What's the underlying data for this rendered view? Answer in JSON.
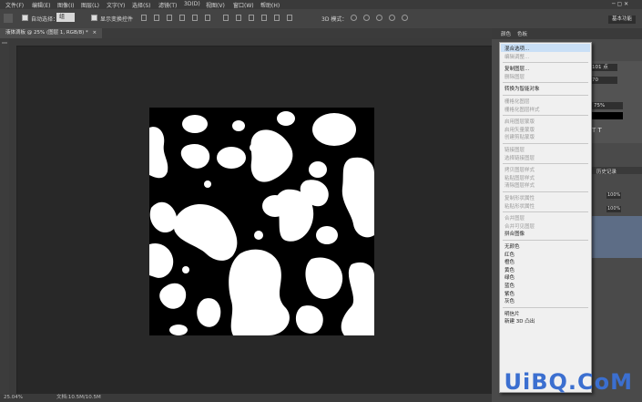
{
  "menubar": {
    "items": [
      "文件(F)",
      "编辑(E)",
      "图像(I)",
      "图层(L)",
      "文字(Y)",
      "选择(S)",
      "滤镜(T)",
      "3D(D)",
      "视图(V)",
      "窗口(W)",
      "帮助(H)"
    ],
    "workspace_label": "基本功能"
  },
  "options_bar": {
    "auto_select_label": "自动选择：",
    "auto_select_value": "组",
    "show_transform_label": "显示变换控件",
    "mode_3d_label": "3D 模式："
  },
  "document": {
    "tab_title": "液体滴板 @ 25% (图层 1, RGB/8) *",
    "close_glyph": "×"
  },
  "status_bar": {
    "zoom": "25.04%",
    "doc_info": "文档:10.5M/10.5M"
  },
  "right_panel": {
    "tabs": [
      "颜色",
      "色板"
    ],
    "values": [
      "101 点",
      "70",
      "75%",
      "100%",
      "100%"
    ],
    "history_tab": "历史记录"
  },
  "context_menu": {
    "items": [
      {
        "label": "混合选项...",
        "enabled": true,
        "highlighted": true
      },
      {
        "label": "编辑调整...",
        "enabled": false
      },
      {
        "sep": true
      },
      {
        "label": "复制图层...",
        "enabled": true
      },
      {
        "label": "删除图层",
        "enabled": false
      },
      {
        "sep": true
      },
      {
        "label": "转换为智能对象",
        "enabled": true
      },
      {
        "sep": true
      },
      {
        "label": "栅格化图层",
        "enabled": false
      },
      {
        "label": "栅格化图层样式",
        "enabled": false
      },
      {
        "sep": true
      },
      {
        "label": "启用图层蒙版",
        "enabled": false
      },
      {
        "label": "启用矢量蒙版",
        "enabled": false
      },
      {
        "label": "创建剪贴蒙版",
        "enabled": false
      },
      {
        "sep": true
      },
      {
        "label": "链接图层",
        "enabled": false
      },
      {
        "label": "选择链接图层",
        "enabled": false
      },
      {
        "sep": true
      },
      {
        "label": "拷贝图层样式",
        "enabled": false
      },
      {
        "label": "粘贴图层样式",
        "enabled": false
      },
      {
        "label": "清除图层样式",
        "enabled": false
      },
      {
        "sep": true
      },
      {
        "label": "复制形状属性",
        "enabled": false
      },
      {
        "label": "粘贴形状属性",
        "enabled": false
      },
      {
        "sep": true
      },
      {
        "label": "合并图层",
        "enabled": false
      },
      {
        "label": "合并可见图层",
        "enabled": false
      },
      {
        "label": "拼合图像",
        "enabled": true
      },
      {
        "sep": true
      },
      {
        "label": "无颜色",
        "enabled": true
      },
      {
        "label": "红色",
        "enabled": true
      },
      {
        "label": "橙色",
        "enabled": true
      },
      {
        "label": "黄色",
        "enabled": true
      },
      {
        "label": "绿色",
        "enabled": true
      },
      {
        "label": "蓝色",
        "enabled": true
      },
      {
        "label": "紫色",
        "enabled": true
      },
      {
        "label": "灰色",
        "enabled": true
      },
      {
        "sep": true
      },
      {
        "label": "明信片",
        "enabled": true
      },
      {
        "label": "新建 3D 凸出",
        "enabled": true
      }
    ]
  },
  "watermark": "UiBQ.CoM"
}
